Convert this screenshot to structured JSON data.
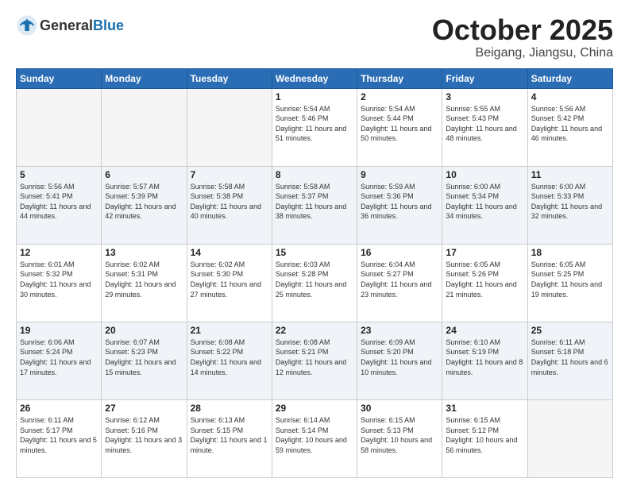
{
  "header": {
    "logo_general": "General",
    "logo_blue": "Blue",
    "title": "October 2025",
    "subtitle": "Beigang, Jiangsu, China"
  },
  "weekdays": [
    "Sunday",
    "Monday",
    "Tuesday",
    "Wednesday",
    "Thursday",
    "Friday",
    "Saturday"
  ],
  "weeks": [
    [
      {
        "day": "",
        "empty": true
      },
      {
        "day": "",
        "empty": true
      },
      {
        "day": "",
        "empty": true
      },
      {
        "day": "1",
        "sunrise": "Sunrise: 5:54 AM",
        "sunset": "Sunset: 5:46 PM",
        "daylight": "Daylight: 11 hours and 51 minutes."
      },
      {
        "day": "2",
        "sunrise": "Sunrise: 5:54 AM",
        "sunset": "Sunset: 5:44 PM",
        "daylight": "Daylight: 11 hours and 50 minutes."
      },
      {
        "day": "3",
        "sunrise": "Sunrise: 5:55 AM",
        "sunset": "Sunset: 5:43 PM",
        "daylight": "Daylight: 11 hours and 48 minutes."
      },
      {
        "day": "4",
        "sunrise": "Sunrise: 5:56 AM",
        "sunset": "Sunset: 5:42 PM",
        "daylight": "Daylight: 11 hours and 46 minutes."
      }
    ],
    [
      {
        "day": "5",
        "sunrise": "Sunrise: 5:56 AM",
        "sunset": "Sunset: 5:41 PM",
        "daylight": "Daylight: 11 hours and 44 minutes."
      },
      {
        "day": "6",
        "sunrise": "Sunrise: 5:57 AM",
        "sunset": "Sunset: 5:39 PM",
        "daylight": "Daylight: 11 hours and 42 minutes."
      },
      {
        "day": "7",
        "sunrise": "Sunrise: 5:58 AM",
        "sunset": "Sunset: 5:38 PM",
        "daylight": "Daylight: 11 hours and 40 minutes."
      },
      {
        "day": "8",
        "sunrise": "Sunrise: 5:58 AM",
        "sunset": "Sunset: 5:37 PM",
        "daylight": "Daylight: 11 hours and 38 minutes."
      },
      {
        "day": "9",
        "sunrise": "Sunrise: 5:59 AM",
        "sunset": "Sunset: 5:36 PM",
        "daylight": "Daylight: 11 hours and 36 minutes."
      },
      {
        "day": "10",
        "sunrise": "Sunrise: 6:00 AM",
        "sunset": "Sunset: 5:34 PM",
        "daylight": "Daylight: 11 hours and 34 minutes."
      },
      {
        "day": "11",
        "sunrise": "Sunrise: 6:00 AM",
        "sunset": "Sunset: 5:33 PM",
        "daylight": "Daylight: 11 hours and 32 minutes."
      }
    ],
    [
      {
        "day": "12",
        "sunrise": "Sunrise: 6:01 AM",
        "sunset": "Sunset: 5:32 PM",
        "daylight": "Daylight: 11 hours and 30 minutes."
      },
      {
        "day": "13",
        "sunrise": "Sunrise: 6:02 AM",
        "sunset": "Sunset: 5:31 PM",
        "daylight": "Daylight: 11 hours and 29 minutes."
      },
      {
        "day": "14",
        "sunrise": "Sunrise: 6:02 AM",
        "sunset": "Sunset: 5:30 PM",
        "daylight": "Daylight: 11 hours and 27 minutes."
      },
      {
        "day": "15",
        "sunrise": "Sunrise: 6:03 AM",
        "sunset": "Sunset: 5:28 PM",
        "daylight": "Daylight: 11 hours and 25 minutes."
      },
      {
        "day": "16",
        "sunrise": "Sunrise: 6:04 AM",
        "sunset": "Sunset: 5:27 PM",
        "daylight": "Daylight: 11 hours and 23 minutes."
      },
      {
        "day": "17",
        "sunrise": "Sunrise: 6:05 AM",
        "sunset": "Sunset: 5:26 PM",
        "daylight": "Daylight: 11 hours and 21 minutes."
      },
      {
        "day": "18",
        "sunrise": "Sunrise: 6:05 AM",
        "sunset": "Sunset: 5:25 PM",
        "daylight": "Daylight: 11 hours and 19 minutes."
      }
    ],
    [
      {
        "day": "19",
        "sunrise": "Sunrise: 6:06 AM",
        "sunset": "Sunset: 5:24 PM",
        "daylight": "Daylight: 11 hours and 17 minutes."
      },
      {
        "day": "20",
        "sunrise": "Sunrise: 6:07 AM",
        "sunset": "Sunset: 5:23 PM",
        "daylight": "Daylight: 11 hours and 15 minutes."
      },
      {
        "day": "21",
        "sunrise": "Sunrise: 6:08 AM",
        "sunset": "Sunset: 5:22 PM",
        "daylight": "Daylight: 11 hours and 14 minutes."
      },
      {
        "day": "22",
        "sunrise": "Sunrise: 6:08 AM",
        "sunset": "Sunset: 5:21 PM",
        "daylight": "Daylight: 11 hours and 12 minutes."
      },
      {
        "day": "23",
        "sunrise": "Sunrise: 6:09 AM",
        "sunset": "Sunset: 5:20 PM",
        "daylight": "Daylight: 11 hours and 10 minutes."
      },
      {
        "day": "24",
        "sunrise": "Sunrise: 6:10 AM",
        "sunset": "Sunset: 5:19 PM",
        "daylight": "Daylight: 11 hours and 8 minutes."
      },
      {
        "day": "25",
        "sunrise": "Sunrise: 6:11 AM",
        "sunset": "Sunset: 5:18 PM",
        "daylight": "Daylight: 11 hours and 6 minutes."
      }
    ],
    [
      {
        "day": "26",
        "sunrise": "Sunrise: 6:11 AM",
        "sunset": "Sunset: 5:17 PM",
        "daylight": "Daylight: 11 hours and 5 minutes."
      },
      {
        "day": "27",
        "sunrise": "Sunrise: 6:12 AM",
        "sunset": "Sunset: 5:16 PM",
        "daylight": "Daylight: 11 hours and 3 minutes."
      },
      {
        "day": "28",
        "sunrise": "Sunrise: 6:13 AM",
        "sunset": "Sunset: 5:15 PM",
        "daylight": "Daylight: 11 hours and 1 minute."
      },
      {
        "day": "29",
        "sunrise": "Sunrise: 6:14 AM",
        "sunset": "Sunset: 5:14 PM",
        "daylight": "Daylight: 10 hours and 59 minutes."
      },
      {
        "day": "30",
        "sunrise": "Sunrise: 6:15 AM",
        "sunset": "Sunset: 5:13 PM",
        "daylight": "Daylight: 10 hours and 58 minutes."
      },
      {
        "day": "31",
        "sunrise": "Sunrise: 6:15 AM",
        "sunset": "Sunset: 5:12 PM",
        "daylight": "Daylight: 10 hours and 56 minutes."
      },
      {
        "day": "",
        "empty": true
      }
    ]
  ]
}
